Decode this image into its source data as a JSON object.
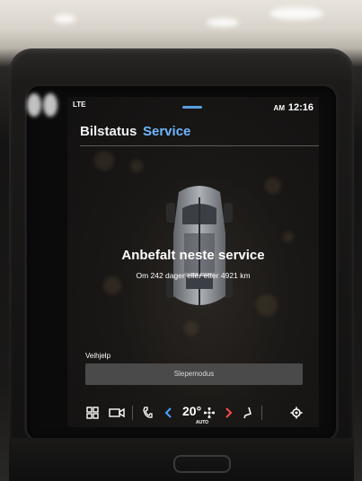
{
  "status_bar": {
    "signal_text": "LTE",
    "ampm": "AM",
    "time": "12:16"
  },
  "tabs": [
    {
      "label": "Bilstatus",
      "active": false
    },
    {
      "label": "Service",
      "active": true
    }
  ],
  "colors": {
    "accent": "#6fb6ff",
    "red_arrow": "#ff4d4d",
    "button_bg": "#4a4a4a"
  },
  "main": {
    "headline": "Anbefalt neste service",
    "subline": "Om 242 dager eller etter 4921 km"
  },
  "roadside": {
    "section_label": "Veihjelp",
    "button_label": "Slepemodus"
  },
  "bottom_bar": {
    "temperature": "20°",
    "temp_mode": "AUTO",
    "icons": [
      "app-grid-icon",
      "camera-icon",
      "phone-icon",
      "temp-decrease-icon",
      "fan-icon",
      "temp-increase-icon",
      "seat-heat-icon",
      "settings-gear-icon"
    ]
  }
}
